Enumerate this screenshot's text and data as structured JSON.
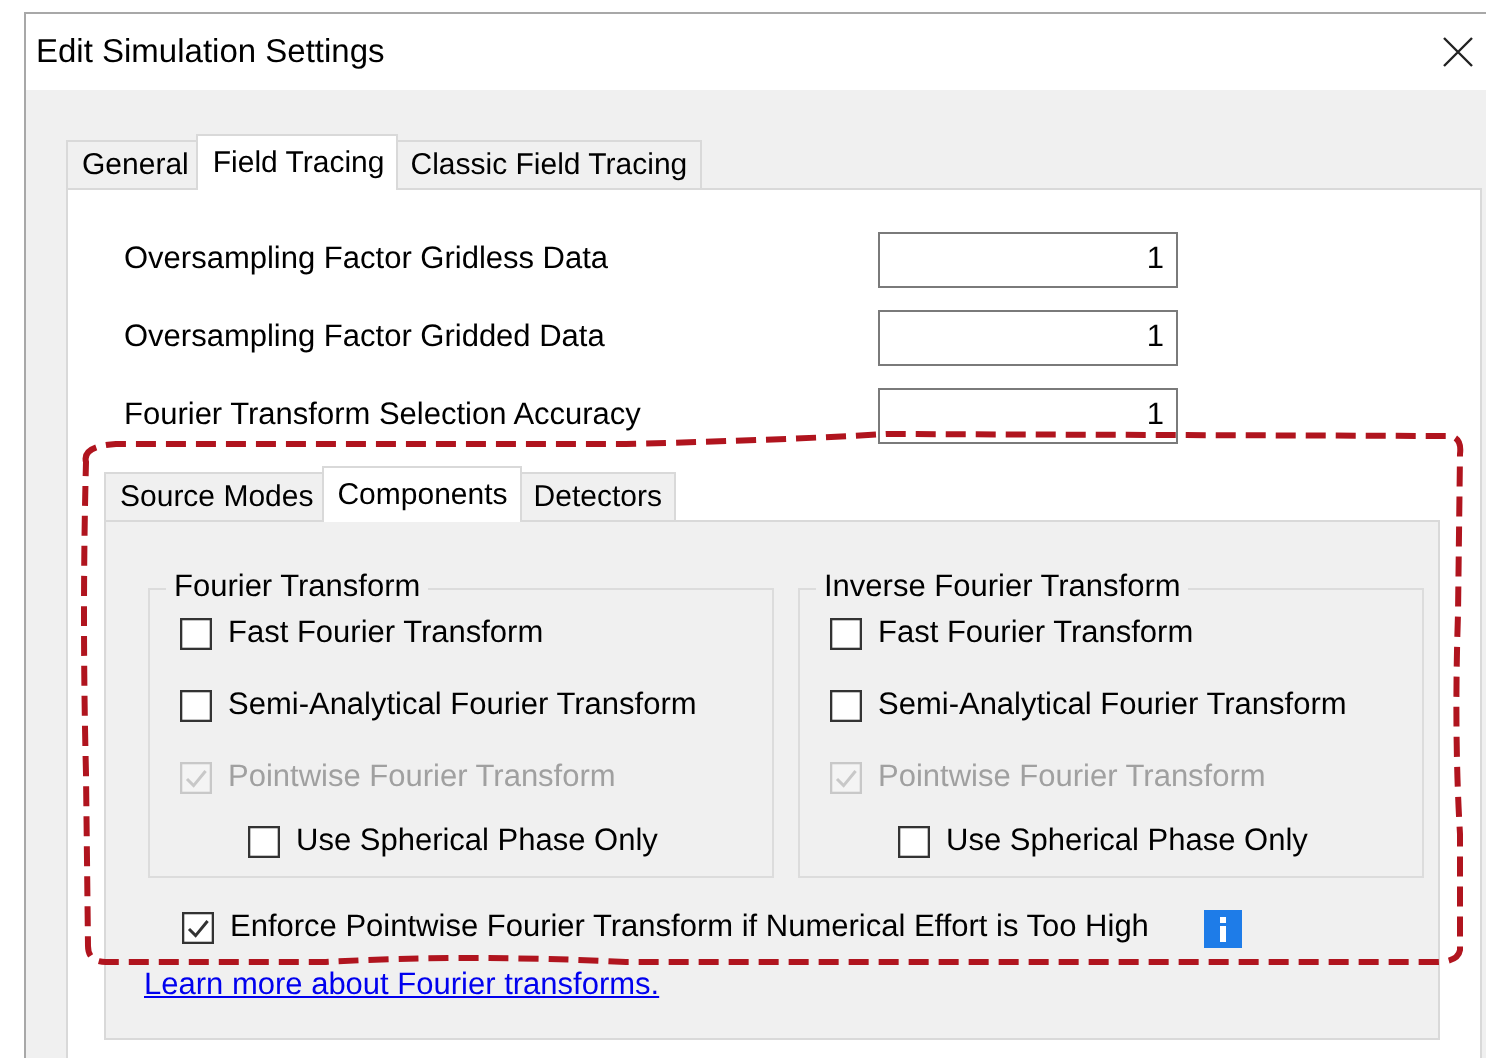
{
  "window": {
    "title": "Edit Simulation Settings"
  },
  "tabs": [
    {
      "label": "General",
      "selected": false
    },
    {
      "label": "Field Tracing",
      "selected": true
    },
    {
      "label": "Classic Field Tracing",
      "selected": false
    }
  ],
  "fields": [
    {
      "label": "Oversampling Factor Gridless Data",
      "value": "1"
    },
    {
      "label": "Oversampling Factor Gridded Data",
      "value": "1"
    },
    {
      "label": "Fourier Transform Selection Accuracy",
      "value": "1"
    }
  ],
  "sub_tabs": [
    {
      "label": "Source Modes",
      "selected": false
    },
    {
      "label": "Components",
      "selected": true
    },
    {
      "label": "Detectors",
      "selected": false
    }
  ],
  "groups": [
    {
      "title": "Fourier Transform",
      "options": [
        {
          "label": "Fast Fourier Transform",
          "checked": false,
          "disabled": false
        },
        {
          "label": "Semi-Analytical Fourier Transform",
          "checked": false,
          "disabled": false
        },
        {
          "label": "Pointwise Fourier Transform",
          "checked": true,
          "disabled": true,
          "children": [
            {
              "label": "Use Spherical Phase Only",
              "checked": false,
              "disabled": false
            }
          ]
        }
      ]
    },
    {
      "title": "Inverse Fourier Transform",
      "options": [
        {
          "label": "Fast Fourier Transform",
          "checked": false,
          "disabled": false
        },
        {
          "label": "Semi-Analytical Fourier Transform",
          "checked": false,
          "disabled": false
        },
        {
          "label": "Pointwise Fourier Transform",
          "checked": true,
          "disabled": true,
          "children": [
            {
              "label": "Use Spherical Phase Only",
              "checked": false,
              "disabled": false
            }
          ]
        }
      ]
    }
  ],
  "enforce": {
    "label": "Enforce Pointwise Fourier Transform if Numerical Effort is Too High",
    "checked": true,
    "disabled": false
  },
  "link": "Learn more about Fourier transforms."
}
